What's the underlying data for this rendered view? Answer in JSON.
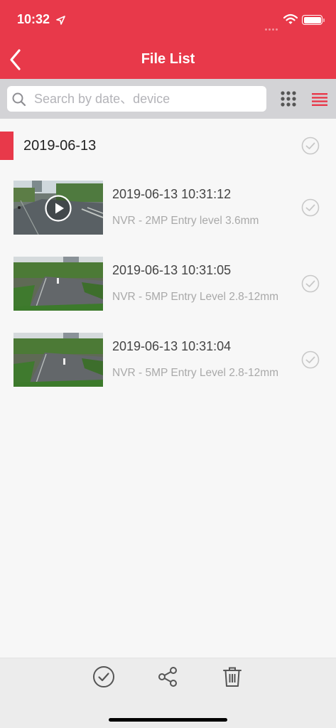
{
  "status_bar": {
    "time": "10:32"
  },
  "header": {
    "title": "File List"
  },
  "search": {
    "placeholder": "Search by date、device",
    "value": ""
  },
  "group": {
    "date": "2019-06-13"
  },
  "files": [
    {
      "datetime": "2019-06-13 10:31:12",
      "device": "NVR - 2MP Entry level 3.6mm",
      "is_video": true
    },
    {
      "datetime": "2019-06-13 10:31:05",
      "device": "NVR - 5MP Entry Level 2.8-12mm",
      "is_video": false
    },
    {
      "datetime": "2019-06-13 10:31:04",
      "device": "NVR - 5MP Entry Level 2.8-12mm",
      "is_video": false
    }
  ],
  "toolbar": {
    "items": [
      "select-all-icon",
      "share-icon",
      "trash-icon"
    ]
  },
  "colors": {
    "accent": "#e8394a",
    "search_bg": "#d3d3d6",
    "toolbar_bg": "#ececec",
    "muted_text": "#a9a9a9"
  }
}
